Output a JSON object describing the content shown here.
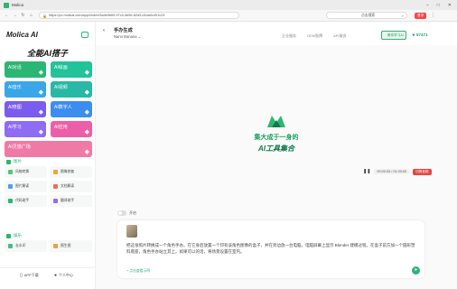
{
  "browser": {
    "tab_title": "Molica",
    "url": "https://pc.molicai.com/appr/index/5a4b9b69-97c3-4b56-82d3-d1ba0c491123",
    "search_text": "点击搜索",
    "login_label": "登录"
  },
  "sidebar": {
    "brand": "Molica AI",
    "slogan": "全能AI搭子",
    "tiles": [
      {
        "label": "AI对话",
        "color": "#2bb673"
      },
      {
        "label": "AI绘画",
        "color": "#22c29a"
      },
      {
        "label": "AI音乐",
        "color": "#3aa6e8"
      },
      {
        "label": "AI视频",
        "color": "#28b8a5"
      },
      {
        "label": "AI修图",
        "color": "#7b5cf0"
      },
      {
        "label": "AI数字人",
        "color": "#3c8df0"
      },
      {
        "label": "AI学习",
        "color": "#8e6cf3"
      },
      {
        "label": "AI应用",
        "color": "#ec5fa8"
      },
      {
        "label": "AI灵感广场",
        "color": "#f07aa6"
      }
    ],
    "section1": "图片",
    "grid1": [
      {
        "label": "风格转换",
        "color": "#58c27d"
      },
      {
        "label": "图像修复",
        "color": "#f2a33a"
      },
      {
        "label": "图片解读",
        "color": "#4a9ef0"
      },
      {
        "label": "文档解读",
        "color": "#f06a5c"
      },
      {
        "label": "代码助手",
        "color": "#2bb673"
      },
      {
        "label": "翻译助手",
        "color": "#9a6cf0"
      }
    ],
    "section2": "娱乐",
    "grid2": [
      {
        "label": "去水印",
        "color": "#3cc08a"
      },
      {
        "label": "图生图",
        "color": "#f0a33a"
      }
    ],
    "footer": {
      "app_download": "APP下载",
      "personal_center": "个人中心"
    }
  },
  "main": {
    "app_title": "手办生成",
    "model": "Nano Banana",
    "top_links": [
      "企业服务",
      "OEM贴牌",
      "API服务"
    ],
    "learn_label": "教你学习AI",
    "credits": "57471",
    "hero_sub": "集大成于一身的",
    "hero_title": "AI工具集合",
    "audio_time": "00:00:03 / 01:00:00",
    "audio_switch": "切换音频",
    "toggle_label": "开启",
    "prompt": "把这张照片转换成一个角色手办。在它身后放置一个印有该角色图像的盒子，并在旁边放一台电脑，电脑屏幕上显示 Blender 建模过程。在盒子前方加一个圆形塑料底座，角色手办站立其上。如果可以的话，将场景设置在室内。",
    "tips": "点击查看示例"
  }
}
